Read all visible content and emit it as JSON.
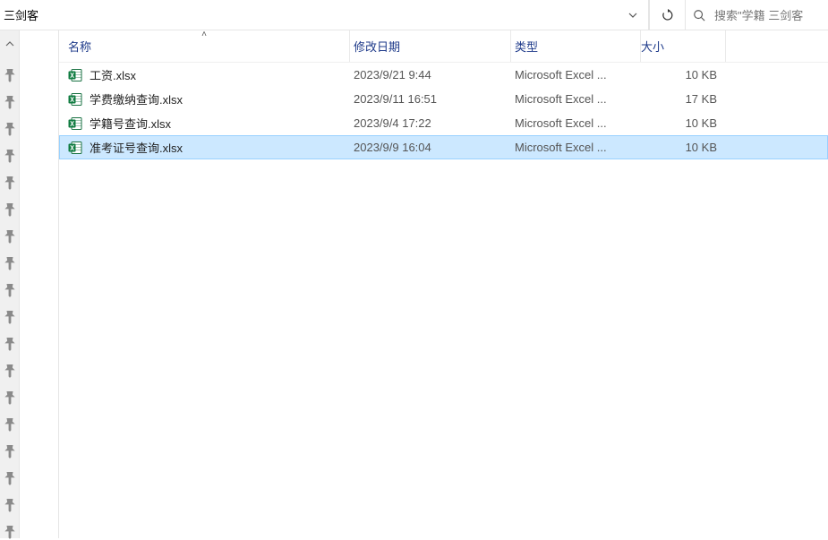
{
  "toolbar": {
    "breadcrumb": "三剑客",
    "search_placeholder": "搜索\"学籍 三剑客"
  },
  "columns": {
    "name": "名称",
    "date": "修改日期",
    "type": "类型",
    "size": "大小"
  },
  "files": [
    {
      "name": "工资.xlsx",
      "date": "2023/9/21 9:44",
      "type": "Microsoft Excel ...",
      "size": "10 KB",
      "selected": false
    },
    {
      "name": "学费缴纳查询.xlsx",
      "date": "2023/9/11 16:51",
      "type": "Microsoft Excel ...",
      "size": "17 KB",
      "selected": false
    },
    {
      "name": "学籍号查询.xlsx",
      "date": "2023/9/4 17:22",
      "type": "Microsoft Excel ...",
      "size": "10 KB",
      "selected": false
    },
    {
      "name": "准考证号查询.xlsx",
      "date": "2023/9/9 16:04",
      "type": "Microsoft Excel ...",
      "size": "10 KB",
      "selected": true
    }
  ],
  "quick_access_count": 18
}
